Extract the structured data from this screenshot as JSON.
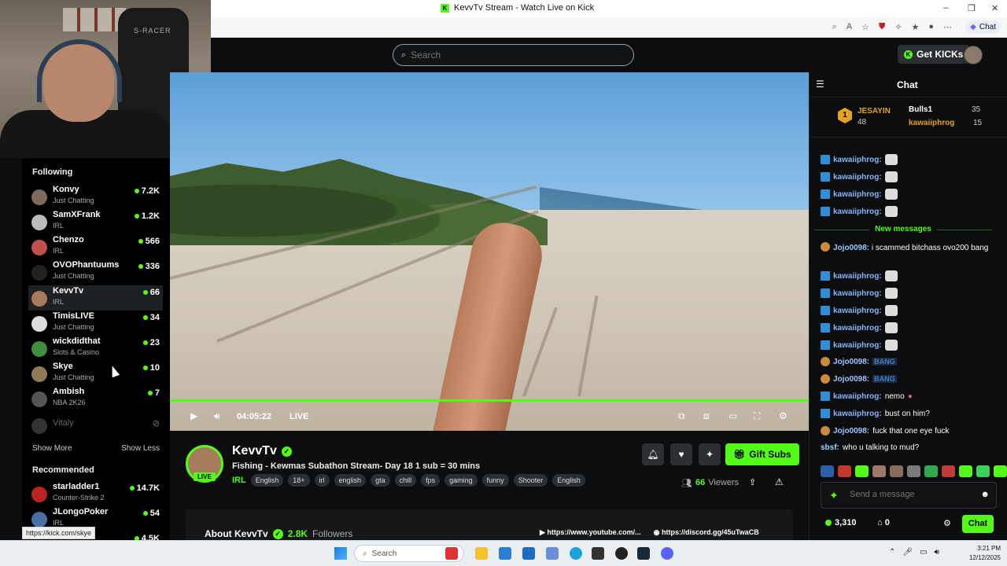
{
  "browser": {
    "title": "KevvTv Stream - Watch Live on Kick",
    "copilot_label": "Chat",
    "status_url": "https://kick.com/skye"
  },
  "topnav": {
    "search_placeholder": "Search",
    "get_kicks_label": "Get KICKs"
  },
  "webcam": {
    "chair_text": "S-RACER"
  },
  "sidebar": {
    "following_heading": "Following",
    "channels": [
      {
        "name": "Konvy",
        "category": "Just Chatting",
        "viewers": "7.2K",
        "live": true
      },
      {
        "name": "SamXFrank",
        "category": "IRL",
        "viewers": "1.2K",
        "live": true
      },
      {
        "name": "Chenzo",
        "category": "IRL",
        "viewers": "566",
        "live": true
      },
      {
        "name": "OVOPhantuums",
        "category": "Just Chatting",
        "viewers": "336",
        "live": true
      },
      {
        "name": "KevvTv",
        "category": "IRL",
        "viewers": "66",
        "live": true,
        "active": true
      },
      {
        "name": "TimisLIVE",
        "category": "Just Chatting",
        "viewers": "34",
        "live": true
      },
      {
        "name": "wickdidthat",
        "category": "Slots & Casino",
        "viewers": "23",
        "live": true
      },
      {
        "name": "Skye",
        "category": "Just Chatting",
        "viewers": "10",
        "live": true
      },
      {
        "name": "Ambish",
        "category": "NBA 2K26",
        "viewers": "7",
        "live": true
      },
      {
        "name": "Vitaly",
        "category": "",
        "viewers": "",
        "live": false
      }
    ],
    "show_more": "Show More",
    "show_less": "Show Less",
    "recommended_heading": "Recommended",
    "recommended": [
      {
        "name": "starladder1",
        "category": "Counter-Strike 2",
        "viewers": "14.7K"
      },
      {
        "name": "JLongoPoker",
        "category": "IRL",
        "viewers": "54"
      },
      {
        "name": "",
        "category": "",
        "viewers": "4.5K"
      }
    ]
  },
  "player": {
    "time": "04:05:22",
    "live_label": "LIVE",
    "progress": 1.0
  },
  "stream": {
    "streamer": "KevvTv",
    "live_badge": "LIVE",
    "title": "Fishing - Kewmas Subathon Stream- Day 18 1 sub = 30 mins",
    "category": "IRL",
    "tags": [
      "English",
      "18+",
      "irl",
      "english",
      "gta",
      "chill",
      "fps",
      "gaming",
      "funny",
      "Shooter",
      "English"
    ],
    "gift_subs_label": "Gift Subs",
    "viewers": "66",
    "viewers_label": "Viewers",
    "about_label": "About KevvTv",
    "followers": "2.8K",
    "followers_label": "Followers",
    "youtube_link": "https://www.youtube.com/...",
    "discord_link": "https://discord.gg/45uTwaCB"
  },
  "chat": {
    "title": "Chat",
    "leaderboard": {
      "first": {
        "rank": "1",
        "name": "JESAYIN",
        "count": "48"
      },
      "second": {
        "name": "Bulls1",
        "count": "35"
      },
      "third": {
        "name": "kawaiiphrog",
        "count": "15"
      }
    },
    "new_messages_label": "New messages",
    "messages": [
      {
        "user": "kawaiiphrog:",
        "text": "",
        "emote": true
      },
      {
        "user": "kawaiiphrog:",
        "text": "",
        "emote": true
      },
      {
        "user": "kawaiiphrog:",
        "text": "",
        "emote": true
      },
      {
        "user": "kawaiiphrog:",
        "text": "",
        "emote": true
      },
      {
        "user": "Jojo0098:",
        "text": "i scammed bitchass ovo200 bang",
        "emote": false
      },
      {
        "user": "kawaiiphrog:",
        "text": "",
        "emote": true
      },
      {
        "user": "kawaiiphrog:",
        "text": "",
        "emote": true
      },
      {
        "user": "kawaiiphrog:",
        "text": "",
        "emote": true
      },
      {
        "user": "kawaiiphrog:",
        "text": "",
        "emote": true
      },
      {
        "user": "kawaiiphrog:",
        "text": "",
        "emote": true
      },
      {
        "user": "Jojo0098:",
        "text": "BANG",
        "emote": false
      },
      {
        "user": "Jojo0098:",
        "text": "BANG",
        "emote": false
      },
      {
        "user": "kawaiiphrog:",
        "text": "nemo",
        "emote": false
      },
      {
        "user": "kawaiiphrog:",
        "text": "bust on him?",
        "emote": false
      },
      {
        "user": "Jojo0098:",
        "text": "fuck that one eye fuck",
        "emote": false
      },
      {
        "user": "sbsf:",
        "text": "who u talking to mud?",
        "emote": false
      }
    ],
    "send_placeholder": "Send a message",
    "points": "3,310",
    "store_count": "0",
    "chat_button": "Chat"
  },
  "taskbar": {
    "search_label": "Search",
    "time": "3:21 PM",
    "date": "12/12/2025"
  },
  "colors": {
    "kick_green": "#53fc18",
    "background": "#0b0d0e"
  }
}
